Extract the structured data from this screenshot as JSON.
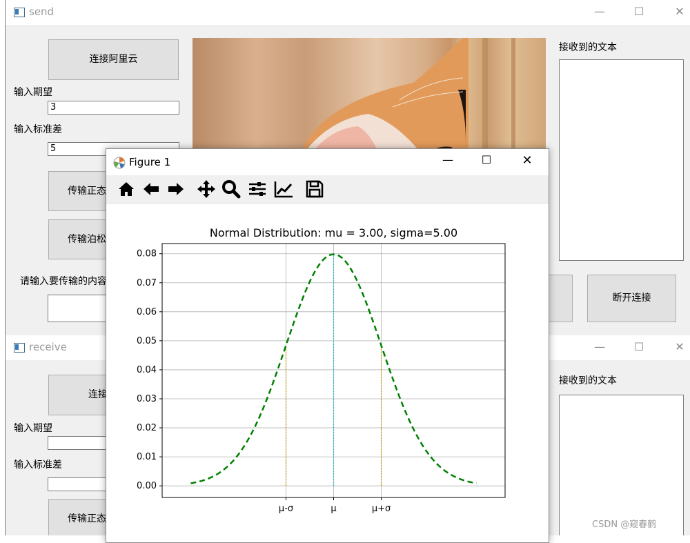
{
  "send_window": {
    "title": "send",
    "connect_button": "连接阿里云",
    "mean_label": "输入期望",
    "mean_value": "3",
    "std_label": "输入标准差",
    "std_value": "5",
    "normal_button": "传输正态",
    "poisson_button": "传输泊松",
    "content_label": "请输入要传输的内容",
    "received_label": "接收到的文本",
    "disconnect_button": "断开连接"
  },
  "receive_window": {
    "title": "receive",
    "connect_button": "连接",
    "mean_label": "输入期望",
    "std_label": "输入标准差",
    "normal_button": "传输正态",
    "received_label": "接收到的文本"
  },
  "figure_window": {
    "title": "Figure 1",
    "toolbar": [
      "home-icon",
      "back-icon",
      "forward-icon",
      "pan-icon",
      "zoom-icon",
      "subplots-icon",
      "edit-axis-icon",
      "save-icon"
    ]
  },
  "chart_data": {
    "type": "line",
    "title": "Normal Distribution: mu = 3.00, sigma=5.00",
    "mu": 3.0,
    "sigma": 5.0,
    "x_range": [
      -12.0,
      18.0
    ],
    "ylim": [
      -0.004,
      0.0835
    ],
    "yticks": [
      0.0,
      0.01,
      0.02,
      0.03,
      0.04,
      0.05,
      0.06,
      0.07,
      0.08
    ],
    "ytick_labels": [
      "0.00",
      "0.01",
      "0.02",
      "0.03",
      "0.04",
      "0.05",
      "0.06",
      "0.07",
      "0.08"
    ],
    "xticks": [
      -2.0,
      3.0,
      8.0
    ],
    "xtick_labels": [
      "μ-σ",
      "μ",
      "μ+σ"
    ],
    "grid": true,
    "series": [
      {
        "color": "#008000",
        "style": "dashed",
        "formula": "normal pdf"
      }
    ],
    "vlines": [
      {
        "x": -2.0,
        "y": 0.0484,
        "color": "#c8a000",
        "style": "dotted"
      },
      {
        "x": 3.0,
        "y": 0.0798,
        "color": "#17becf",
        "style": "dotted"
      },
      {
        "x": 8.0,
        "y": 0.0484,
        "color": "#c8a000",
        "style": "dotted"
      }
    ]
  },
  "watermark": "CSDN @窥春鹤"
}
